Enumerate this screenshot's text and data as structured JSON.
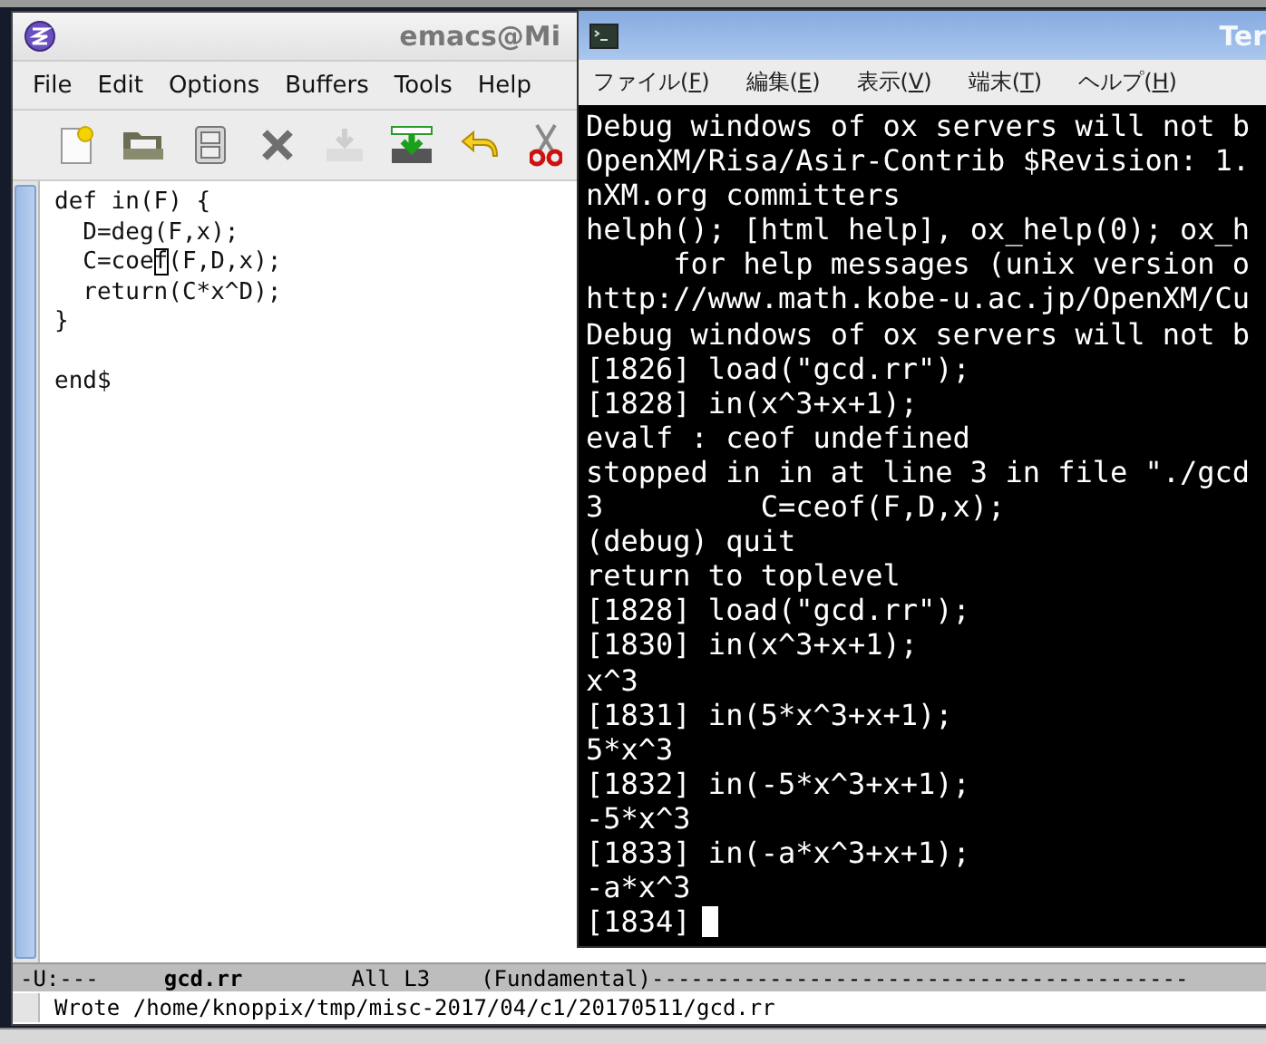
{
  "emacs": {
    "title": "emacs@Mi",
    "menu": [
      "File",
      "Edit",
      "Options",
      "Buffers",
      "Tools",
      "Help"
    ],
    "toolbar": [
      {
        "kind": "new",
        "disabled": false
      },
      {
        "kind": "open",
        "disabled": false
      },
      {
        "kind": "save",
        "disabled": false
      },
      {
        "kind": "close",
        "disabled": false
      },
      {
        "kind": "download",
        "disabled": true
      },
      {
        "kind": "saveas",
        "disabled": false
      },
      {
        "kind": "undo",
        "disabled": false
      },
      {
        "kind": "cut",
        "disabled": false
      }
    ],
    "editor": {
      "blocks": [
        [
          {
            "kind": "plain",
            "text": "def in(F) {"
          },
          {
            "kind": "plain",
            "text": "  D=deg(F,x);"
          },
          {
            "kind": "cursor",
            "before": "  C=coe",
            "at": "f",
            "after": "(F,D,x);"
          },
          {
            "kind": "plain",
            "text": "  return(C*x^D);"
          },
          {
            "kind": "plain",
            "text": "}"
          }
        ],
        [
          {
            "kind": "plain",
            "text": "end$"
          }
        ]
      ]
    },
    "mode_line": {
      "status": "-U:---",
      "buffer": "gcd.rr",
      "position": "All L3",
      "mode": "(Fundamental)",
      "fill": "-----------------------------------------"
    },
    "echo_area": "Wrote /home/knoppix/tmp/misc-2017/04/c1/20170511/gcd.rr"
  },
  "terminal": {
    "title": "Ter",
    "menu": [
      {
        "before": "ファイル(",
        "key": "F",
        "after": ")"
      },
      {
        "before": "編集(",
        "key": "E",
        "after": ")"
      },
      {
        "before": "表示(",
        "key": "V",
        "after": ")"
      },
      {
        "before": "端末(",
        "key": "T",
        "after": ")"
      },
      {
        "before": "ヘルプ(",
        "key": "H",
        "after": ")"
      }
    ],
    "lines": [
      "Debug windows of ox servers will not b",
      "OpenXM/Risa/Asir-Contrib $Revision: 1.",
      "nXM.org committers",
      "helph(); [html help], ox_help(0); ox_h",
      "     for help messages (unix version o",
      "http://www.math.kobe-u.ac.jp/OpenXM/Cu",
      "Debug windows of ox servers will not b",
      "[1826] load(\"gcd.rr\");",
      "[1828] in(x^3+x+1);",
      "evalf : ceof undefined",
      "stopped in in at line 3 in file \"./gcd",
      "3         C=ceof(F,D,x);",
      "(debug) quit",
      "return to toplevel",
      "[1828] load(\"gcd.rr\");",
      "[1830] in(x^3+x+1);",
      "x^3",
      "[1831] in(5*x^3+x+1);",
      "5*x^3",
      "[1832] in(-5*x^3+x+1);",
      "-5*x^3",
      "[1833] in(-a*x^3+x+1);",
      "-a*x^3",
      "[1834]"
    ]
  }
}
